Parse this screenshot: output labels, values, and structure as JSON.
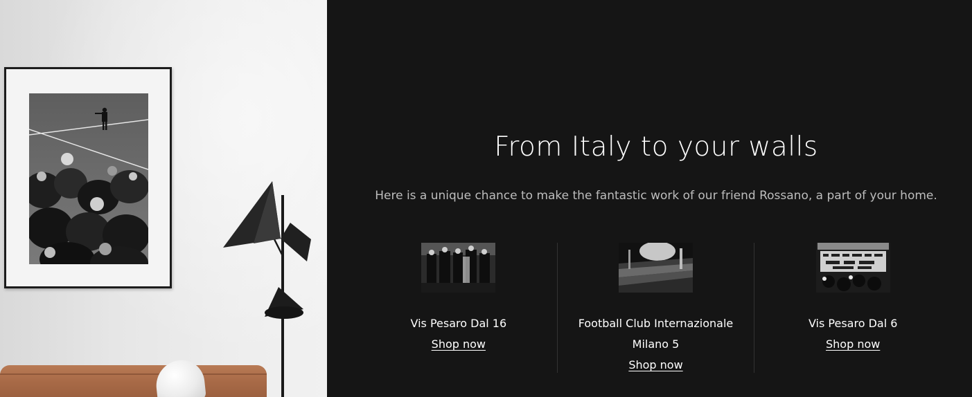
{
  "section": {
    "title": "From Italy to your walls",
    "subtitle": "Here is a unique chance to make the fantastic work of our friend Rossano, a part of your home."
  },
  "products": [
    {
      "name": "Vis Pesaro Dal 16",
      "link_label": "Shop now"
    },
    {
      "name": "Football Club Internazionale Milano 5",
      "link_label": "Shop now"
    },
    {
      "name": "Vis Pesaro Dal 6",
      "link_label": "Shop now"
    }
  ],
  "colors": {
    "background": "#151515",
    "text": "#ffffff",
    "subtitle": "#bdbdbd",
    "divider": "#333333"
  }
}
